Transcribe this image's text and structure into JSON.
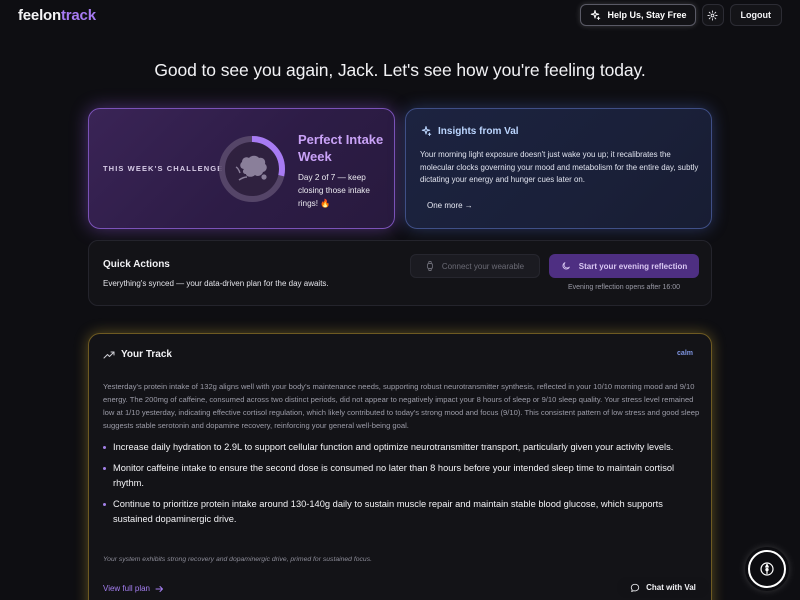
{
  "brand": {
    "part1": "feelon",
    "part2": "track"
  },
  "header": {
    "help_label": "Help Us, Stay Free",
    "logout_label": "Logout"
  },
  "greeting": "Good to see you again, Jack. Let's see how you're feeling today.",
  "challenge": {
    "tag": "THIS WEEK'S CHALLENGE",
    "title": "Perfect Intake Week",
    "subtitle": "Day 2 of 7 — keep closing those intake rings! 🔥",
    "progress": 0.2857,
    "accent": "#a77bf3"
  },
  "insights": {
    "title": "Insights from Val",
    "text": "Your morning light exposure doesn't just wake you up; it recalibrates the molecular clocks governing your mood and metabolism for the entire day, subtly dictating your energy and hunger cues later on.",
    "more_label": "One more →"
  },
  "quick_actions": {
    "title": "Quick Actions",
    "subtitle": "Everything's synced — your data-driven plan for the day awaits.",
    "wearable_label": "Connect your wearable",
    "evening_label": "Start your evening reflection",
    "evening_note": "Evening reflection opens after 16:00"
  },
  "track": {
    "title": "Your Track",
    "badge": "calm",
    "paragraph": "Yesterday's protein intake of 132g aligns well with your body's maintenance needs, supporting robust neurotransmitter synthesis, reflected in your 10/10 morning mood and 9/10 energy. The 200mg of caffeine, consumed across two distinct periods, did not appear to negatively impact your 8 hours of sleep or 9/10 sleep quality. Your stress level remained low at 1/10 yesterday, indicating effective cortisol regulation, which likely contributed to today's strong mood and focus (9/10). This consistent pattern of low stress and good sleep suggests stable serotonin and dopamine recovery, reinforcing your general well-being goal.",
    "items": [
      "Increase daily hydration to 2.9L to support cellular function and optimize neurotransmitter transport, particularly given your activity levels.",
      "Monitor caffeine intake to ensure the second dose is consumed no later than 8 hours before your intended sleep time to maintain cortisol rhythm.",
      "Continue to prioritize protein intake around 130-140g daily to sustain muscle repair and maintain stable blood glucose, which supports sustained dopaminergic drive."
    ],
    "footnote": "Your system exhibits strong recovery and dopaminergic drive, primed for sustained focus.",
    "link_label": "View full plan"
  },
  "chat_label": "Chat with Val",
  "icons": {
    "help": "sparkle-icon",
    "settings": "gear-icon",
    "insights": "sparkle-icon",
    "wearable": "watch-icon",
    "evening": "moon-icon",
    "track": "trend-up-icon",
    "chat": "chat-bubble-icon",
    "fab": "compass-icon"
  }
}
